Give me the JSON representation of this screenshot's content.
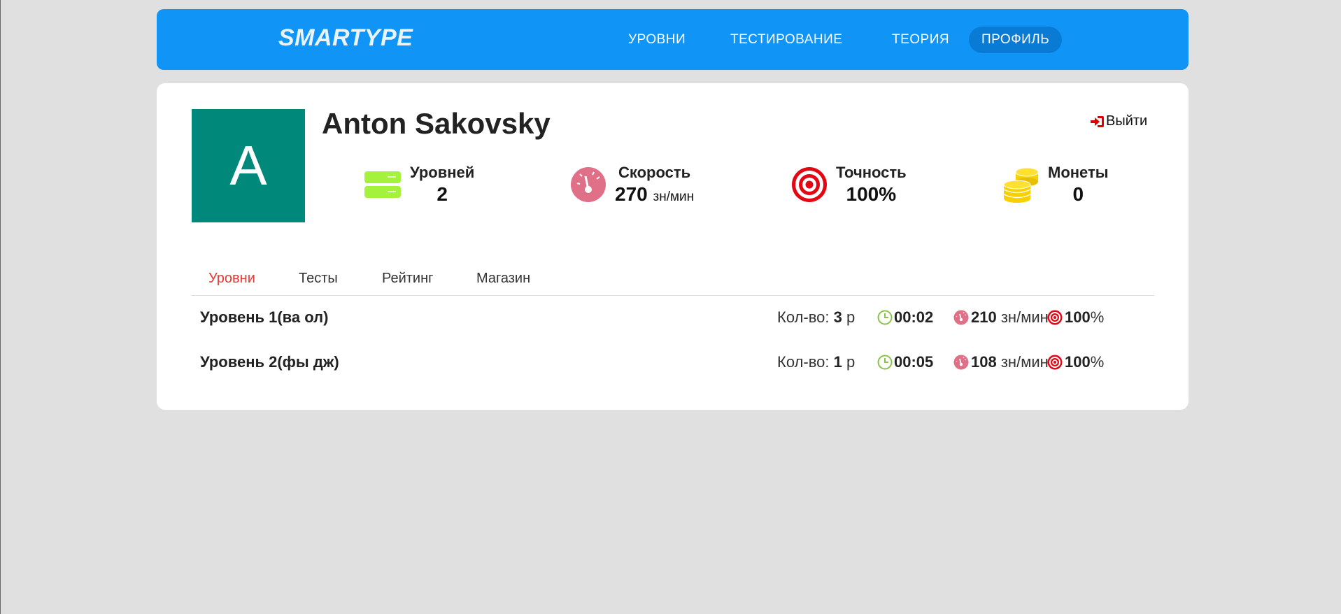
{
  "nav": {
    "logo": "SMARTYPE",
    "items": [
      {
        "label": "УРОВНИ"
      },
      {
        "label": "ТЕСТИРОВАНИЕ"
      },
      {
        "label": "ТЕОРИЯ"
      },
      {
        "label": "ПРОФИЛЬ"
      }
    ]
  },
  "profile": {
    "avatar_letter": "A",
    "name": "Anton Sakovsky",
    "logout": "Выйти"
  },
  "stats": {
    "levels": {
      "label": "Уровней",
      "value": "2"
    },
    "speed": {
      "label": "Скорость",
      "value": "270",
      "unit": "зн/мин"
    },
    "accuracy": {
      "label": "Точность",
      "value": "100%"
    },
    "coins": {
      "label": "Монеты",
      "value": "0"
    }
  },
  "tabs": [
    {
      "label": "Уровни"
    },
    {
      "label": "Тесты"
    },
    {
      "label": "Рейтинг"
    },
    {
      "label": "Магазин"
    }
  ],
  "levels": [
    {
      "title": "Уровень 1(ва ол)",
      "count_label": "Кол-во:",
      "count": "3",
      "count_unit": "р",
      "time": "00:02",
      "speed": "210",
      "speed_unit": "зн/мин",
      "accuracy": "100",
      "accuracy_unit": "%"
    },
    {
      "title": "Уровень 2(фы дж)",
      "count_label": "Кол-во:",
      "count": "1",
      "count_unit": "р",
      "time": "00:05",
      "speed": "108",
      "speed_unit": "зн/мин",
      "accuracy": "100",
      "accuracy_unit": "%"
    }
  ],
  "colors": {
    "nav_bg": "#1094f6",
    "avatar_bg": "#00897b",
    "active_tab": "#e53935",
    "page_bg": "#e0e0e0"
  }
}
